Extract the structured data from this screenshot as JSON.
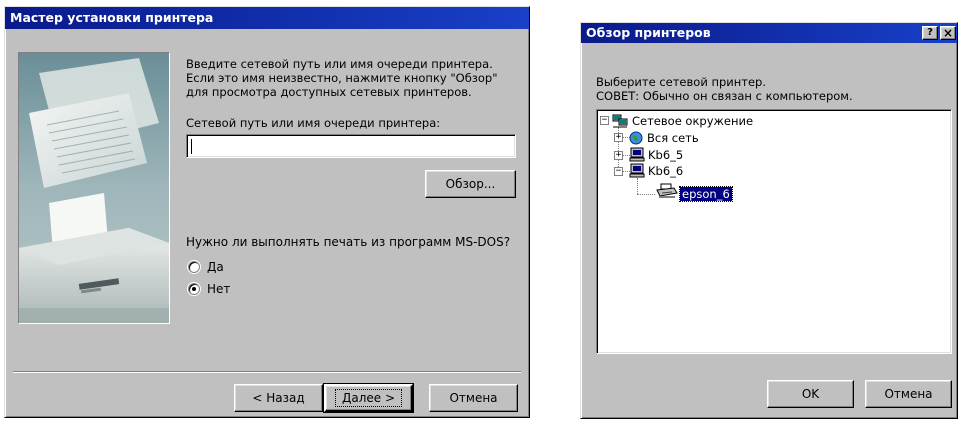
{
  "wizard": {
    "title": "Мастер установки принтера",
    "description_lines": [
      "Введите сетевой путь или имя очереди принтера.",
      "Если это имя неизвестно, нажмите кнопку \"Обзор\"",
      "для просмотра доступных сетевых принтеров."
    ],
    "path_label": "Сетевой путь или имя очереди принтера:",
    "path_value": "",
    "browse_label": "Обзор...",
    "msdos_question": "Нужно ли выполнять печать из программ MS-DOS?",
    "options": [
      {
        "label": "Да",
        "checked": false
      },
      {
        "label": "Нет",
        "checked": true
      }
    ],
    "back_label": "< Назад",
    "next_label": "Далее >",
    "cancel_label": "Отмена"
  },
  "browse_dialog": {
    "title": "Обзор принтеров",
    "help_button": "?",
    "close_button": "×",
    "prompt_line1": "Выберите сетевой принтер.",
    "prompt_line2": "СОВЕТ: Обычно он связан с компьютером.",
    "tree": [
      {
        "label": "Сетевое окружение",
        "icon": "network-neighborhood-icon",
        "expander": "−",
        "level": 0
      },
      {
        "label": "Вся сеть",
        "icon": "globe-icon",
        "expander": "+",
        "level": 1
      },
      {
        "label": "Kb6_5",
        "icon": "computer-icon",
        "expander": "+",
        "level": 1
      },
      {
        "label": "Kb6_6",
        "icon": "computer-icon",
        "expander": "−",
        "level": 1
      },
      {
        "label": "epson_6",
        "icon": "printer-icon",
        "expander": "",
        "level": 2,
        "selected": true
      }
    ],
    "ok_label": "OK",
    "cancel_label": "Отмена"
  },
  "colors": {
    "titlebar_start": "#0a1a8a",
    "titlebar_end": "#1840c8",
    "face": "#c0c0c0",
    "selection": "#000080"
  }
}
